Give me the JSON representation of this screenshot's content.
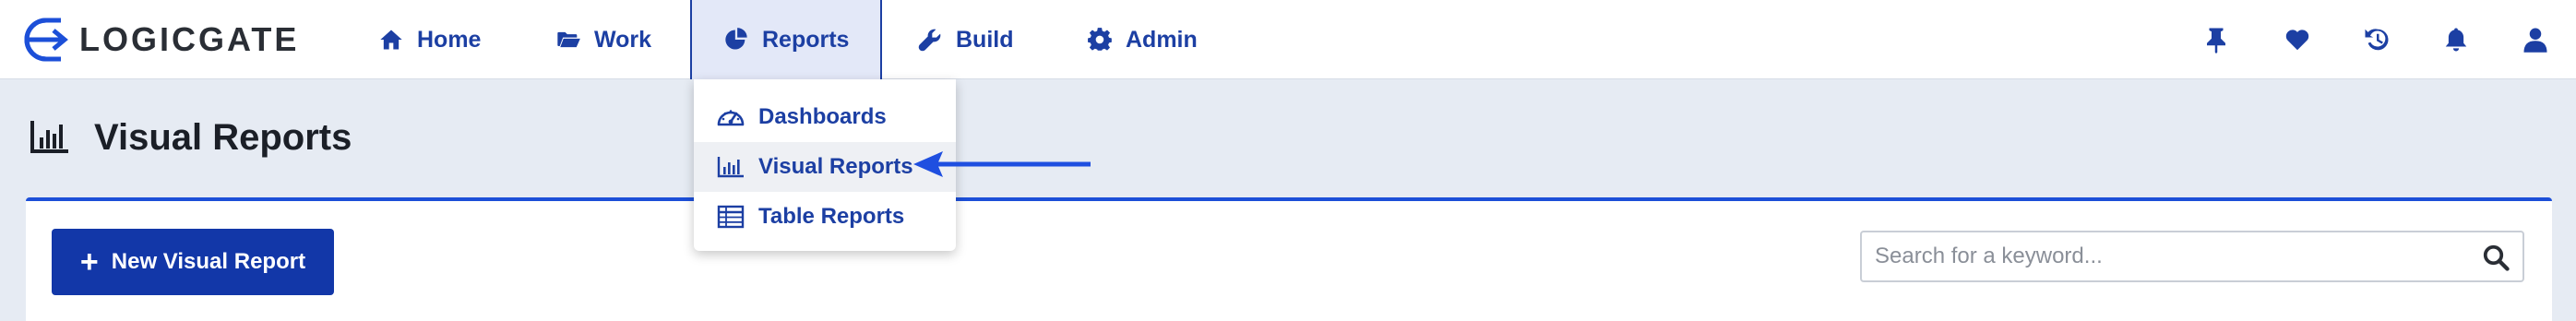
{
  "brand": {
    "name": "LOGICGATE"
  },
  "nav": {
    "items": [
      {
        "label": "Home",
        "icon": "home-icon"
      },
      {
        "label": "Work",
        "icon": "folder-open-icon"
      },
      {
        "label": "Reports",
        "icon": "pie-chart-icon",
        "active": true
      },
      {
        "label": "Build",
        "icon": "wrench-icon"
      },
      {
        "label": "Admin",
        "icon": "gear-icon"
      }
    ],
    "right_icons": [
      "pin-icon",
      "heart-icon",
      "history-icon",
      "bell-icon",
      "user-icon"
    ]
  },
  "reports_menu": {
    "items": [
      {
        "label": "Dashboards",
        "icon": "gauge-icon"
      },
      {
        "label": "Visual Reports",
        "icon": "bar-chart-icon",
        "highlighted": true
      },
      {
        "label": "Table Reports",
        "icon": "table-icon"
      }
    ]
  },
  "page": {
    "title": "Visual Reports",
    "title_icon": "bar-chart-icon"
  },
  "toolbar": {
    "new_button_label": "New Visual Report",
    "search_placeholder": "Search for a keyword..."
  },
  "colors": {
    "primary": "#1c3fa3",
    "button": "#1237a8",
    "accent_border": "#1c4fd8",
    "arrow": "#1f4fe0",
    "page_bg": "#e6ebf3"
  }
}
